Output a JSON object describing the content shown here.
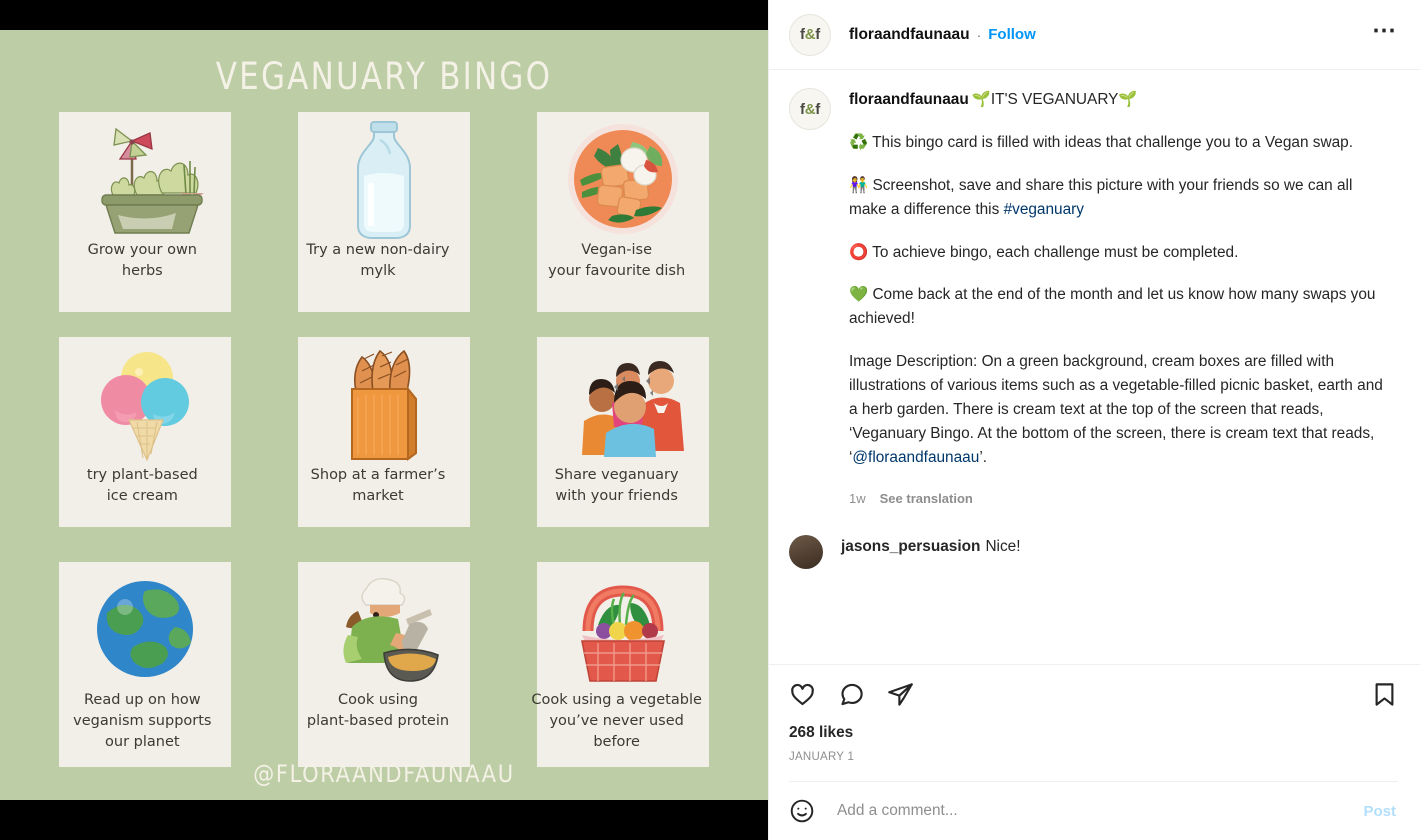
{
  "header": {
    "avatar_initials": "f&f",
    "username": "floraandfaunaau",
    "separator": "·",
    "follow_label": "Follow",
    "more_label": "…"
  },
  "caption": {
    "username": "floraandfaunaau",
    "title_line": "🌱IT'S VEGANUARY🌱",
    "paragraphs": [
      "♻️ This bingo card is filled with ideas that challenge you to a Vegan swap.",
      "👫 Screenshot, save and share this picture with your friends so we can all make a difference this ",
      "⭕ To achieve bingo, each challenge must be completed.",
      "💚 Come back at the end of the month and let us know how many swaps you achieved!",
      "Image Description: On a green background, cream boxes are filled with illustrations of various items such as a vegetable-filled picnic basket, earth and a herb garden. There is cream text at the top of the screen that reads, ‘Veganuary Bingo. At the bottom of the screen, there is cream text that reads, ‘"
    ],
    "hashtag": "#veganuary",
    "mention": "@floraandfaunaau",
    "tail": "’.",
    "timestamp": "1w",
    "translate_label": "See translation"
  },
  "comments": [
    {
      "username": "jasons_persuasion",
      "text": "Nice!"
    }
  ],
  "actions": {
    "like_icon": "heart-icon",
    "comment_icon": "comment-icon",
    "share_icon": "share-icon",
    "save_icon": "bookmark-icon",
    "likes_text": "268 likes",
    "date_text": "JANUARY 1"
  },
  "comment_box": {
    "emoji_icon": "emoji-icon",
    "placeholder": "Add a comment...",
    "post_label": "Post"
  },
  "media": {
    "title": "VEGANUARY BINGO",
    "handle": "@FLORAANDFAUNAAU",
    "background_color": "#bdcda5",
    "card_color": "#f2efe8",
    "text_color": "#f4f1e6",
    "cells": [
      {
        "label": "Grow your own\nherbs",
        "art": "herb-planter"
      },
      {
        "label": "Try a new non-dairy\nmylk",
        "art": "milk-bottle"
      },
      {
        "label": "Vegan-ise\nyour favourite dish",
        "art": "vegan-dish-bowl"
      },
      {
        "label": "try plant-based\nice cream",
        "art": "ice-cream-cone"
      },
      {
        "label": "Shop at a farmer’s\nmarket",
        "art": "bread-bag"
      },
      {
        "label": "Share veganuary\nwith your friends",
        "art": "friends-group"
      },
      {
        "label": "Read up on how\nveganism supports\nour planet",
        "art": "earth-globe"
      },
      {
        "label": "Cook using\nplant-based protein",
        "art": "cooking-person"
      },
      {
        "label": "Cook using a vegetable\nyou’ve never used\nbefore",
        "art": "vegetable-basket"
      }
    ]
  }
}
